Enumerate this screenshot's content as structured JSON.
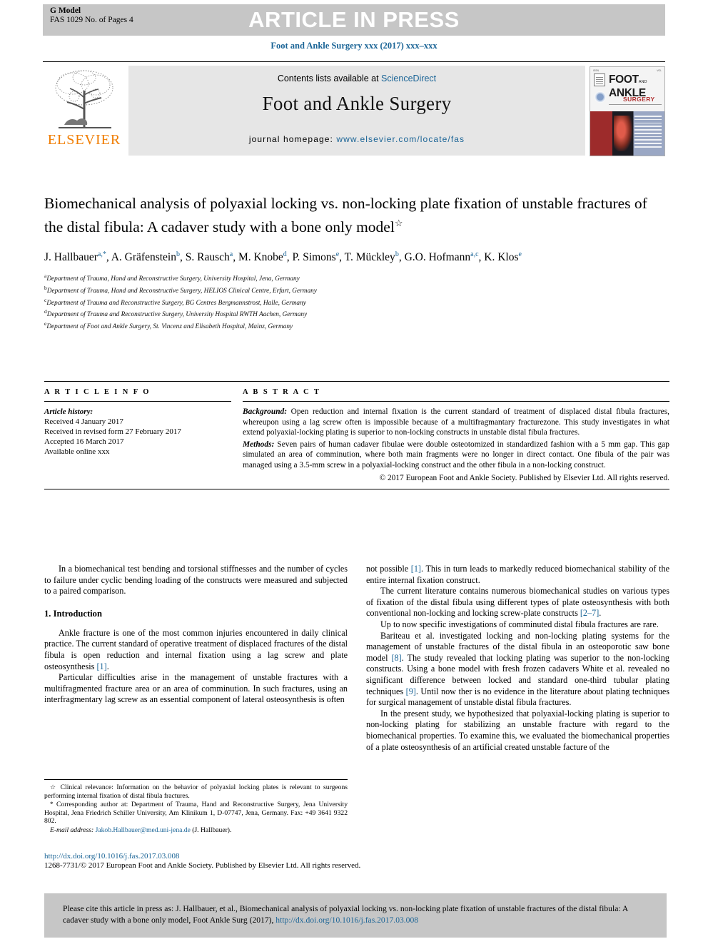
{
  "header": {
    "g_model_label": "G Model",
    "g_model_id": "FAS 1029 No. of Pages 4",
    "press_banner": "ARTICLE IN PRESS",
    "journal_citation_line": "Foot and Ankle Surgery xxx (2017) xxx–xxx"
  },
  "masthead": {
    "contents_prefix": "Contents lists available at ",
    "contents_link": "ScienceDirect",
    "journal_name": "Foot and Ankle Surgery",
    "homepage_label": "journal homepage:",
    "homepage_url": "www.elsevier.com/locate/fas",
    "publisher": "ELSEVIER",
    "cover": {
      "title_line1": "FOOT",
      "title_and": "AND",
      "title_line2": "ANKLE",
      "subtitle": "SURGERY"
    }
  },
  "article": {
    "title": "Biomechanical analysis of polyaxial locking vs. non-locking plate fixation of unstable fractures of the distal fibula: A cadaver study with a bone only model",
    "title_marker": "☆",
    "authors_html": "J. Hallbauer<sup>a,*</sup>, A. Gräfenstein<sup>b</sup>, S. Rausch<sup>a</sup>, M. Knobe<sup>d</sup>, P. Simons<sup>e</sup>, T. Mückley<sup>b</sup>, G.O. Hofmann<sup>a,c</sup>, K. Klos<sup>e</sup>",
    "affiliations": [
      {
        "mark": "a",
        "text": "Department of Trauma, Hand and Reconstructive Surgery, University Hospital, Jena, Germany"
      },
      {
        "mark": "b",
        "text": "Department of Trauma, Hand and Reconstructive Surgery, HELIOS Clinical Centre, Erfurt, Germany"
      },
      {
        "mark": "c",
        "text": "Department of Trauma and Reconstructive Surgery, BG Centres Bergmannstrost, Halle, Germany"
      },
      {
        "mark": "d",
        "text": "Department of Trauma and Reconstructive Surgery, University Hospital RWTH Aachen, Germany"
      },
      {
        "mark": "e",
        "text": "Department of Foot and Ankle Surgery, St. Vincenz and Elisabeth Hospital, Mainz, Germany"
      }
    ]
  },
  "article_info": {
    "heading": "A R T I C L E   I N F O",
    "history_label": "Article history:",
    "history": [
      "Received 4 January 2017",
      "Received in revised form 27 February 2017",
      "Accepted 16 March 2017",
      "Available online xxx"
    ]
  },
  "abstract": {
    "heading": "A B S T R A C T",
    "background_label": "Background:",
    "background_text": " Open reduction and internal fixation is the current standard of treatment of displaced distal fibula fractures, whereupon using a lag screw often is impossible because of a multifragmantary fracturezone. This study investigates in what extend polyaxial-locking plating is superior to non-locking constructs in unstable distal fibula fractures.",
    "methods_label": "Methods:",
    "methods_text": " Seven pairs of human cadaver fibulae were double osteotomized in standardized fashion with a 5 mm gap. This gap simulated an area of comminution, where both main fragments were no longer in direct contact. One fibula of the pair was managed using a 3.5-mm screw in a polyaxial-locking construct and the other fibula in a non-locking construct.",
    "copyright": "© 2017 European Foot and Ankle Society. Published by Elsevier Ltd. All rights reserved."
  },
  "body": {
    "left_column": {
      "lead_paragraph": "In a biomechanical test bending and torsional stiffnesses and the number of cycles to failure under cyclic bending loading of the constructs were measured and subjected to a paired comparison.",
      "section_heading": "1. Introduction",
      "paragraph_1_a": "Ankle fracture is one of the most common injuries encountered in daily clinical practice. The current standard of operative treatment of displaced fractures of the distal fibula is open reduction and internal fixation using a lag screw and plate osteosynthesis ",
      "paragraph_1_ref": "[1]",
      "paragraph_1_b": ".",
      "paragraph_2": "Particular difficulties arise in the management of unstable fractures with a multifragmented fracture area or an area of comminution. In such fractures, using an interfragmentary lag screw as an essential component of lateral osteosynthesis is often"
    },
    "right_column": {
      "paragraph_1_a": "not possible ",
      "paragraph_1_ref": "[1]",
      "paragraph_1_b": ". This in turn leads to markedly reduced biomechanical stability of the entire internal fixation construct.",
      "paragraph_2_a": "The current literature contains numerous biomechanical studies on various types of fixation of the distal fibula using different types of plate osteosynthesis with both conventional non-locking and locking screw-plate constructs ",
      "paragraph_2_ref": "[2–7]",
      "paragraph_2_b": ".",
      "paragraph_3": "Up to now specific investigations of comminuted distal fibula fractures are rare.",
      "paragraph_4_a": "Bariteau et al. investigated locking and non-locking plating systems for the management of unstable fractures of the distal fibula in an osteoporotic saw bone model ",
      "paragraph_4_ref1": "[8]",
      "paragraph_4_b": ". The study revealed that locking plating was superior to the non-locking constructs. Using a bone model with fresh frozen cadavers White et al. revealed no significant difference between locked and standard one-third tubular plating techniques ",
      "paragraph_4_ref2": "[9]",
      "paragraph_4_c": ". Until now ther is no evidence in the literature about plating techniques for surgical management of unstable distal fibula fractures.",
      "paragraph_5": "In the present study, we hypothesized that polyaxial-locking plating is superior to non-locking plating for stabilizing an unstable fracture with regard to the biomechanical properties. To examine this, we evaluated the biomechanical properties of a plate osteosynthesis of an artificial created unstable facture of the"
    }
  },
  "footnotes": {
    "clinical_relevance_symbol": "☆",
    "clinical_relevance": " Clinical relevance: Information on the behavior of polyaxial locking plates is relevant to surgeons performing internal fixation of distal fibula fractures.",
    "corresponding_symbol": "*",
    "corresponding_author": " Corresponding author at: Department of Trauma, Hand and Reconstructive Surgery, Jena University Hospital, Jena Friedrich Schiller University, Am Klinikum 1, D-07747, Jena, Germany. Fax: +49 3641 9322 802.",
    "email_label": "E-mail address:",
    "email_address": "Jakob.Hallbauer@med.uni-jena.de",
    "email_owner": " (J. Hallbauer)."
  },
  "footer": {
    "doi_url": "http://dx.doi.org/10.1016/j.fas.2017.03.008",
    "issn_line": "1268-7731/© 2017 European Foot and Ankle Society. Published by Elsevier Ltd. All rights reserved."
  },
  "cite_box": {
    "text": "Please cite this article in press as: J. Hallbauer, et al., Biomechanical analysis of polyaxial locking vs. non-locking plate fixation of unstable fractures of the distal fibula: A cadaver study with a bone only model, Foot Ankle Surg (2017), ",
    "doi": "http://dx.doi.org/10.1016/j.fas.2017.03.008"
  },
  "colors": {
    "link_blue": "#1a6496",
    "banner_grey": "#c6c6c6",
    "masthead_grey": "#e6e6e6",
    "elsevier_orange": "#f07d00"
  }
}
